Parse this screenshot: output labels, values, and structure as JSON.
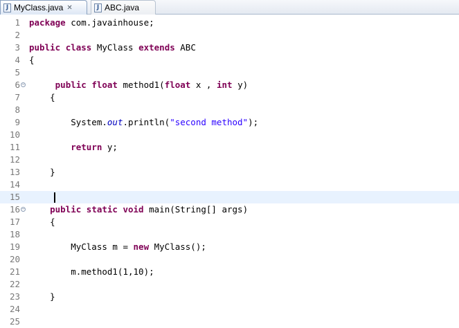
{
  "tabs": [
    {
      "label": "MyClass.java",
      "active": true,
      "icon": "java-file-icon",
      "close_glyph": "✕"
    },
    {
      "label": "ABC.java",
      "active": false,
      "icon": "java-file-icon"
    }
  ],
  "icon_glyph": "J",
  "fold_glyph": "−",
  "colors": {
    "keyword": "#7f0055",
    "string": "#2a00ff",
    "static_field": "#0000c0",
    "line_number": "#787878",
    "current_line": "#e8f2fe"
  },
  "editor": {
    "current_line": 15,
    "lines": [
      {
        "n": "1",
        "t": [
          {
            "k": "kw",
            "s": "package"
          },
          {
            "s": " com.javainhouse;"
          }
        ]
      },
      {
        "n": "2",
        "t": []
      },
      {
        "n": "3",
        "t": [
          {
            "k": "kw",
            "s": "public"
          },
          {
            "s": " "
          },
          {
            "k": "kw",
            "s": "class"
          },
          {
            "s": " MyClass "
          },
          {
            "k": "kw",
            "s": "extends"
          },
          {
            "s": " ABC"
          }
        ]
      },
      {
        "n": "4",
        "t": [
          {
            "s": "{"
          }
        ]
      },
      {
        "n": "5",
        "t": []
      },
      {
        "n": "6",
        "fold": true,
        "t": [
          {
            "s": "     "
          },
          {
            "k": "kw",
            "s": "public"
          },
          {
            "s": " "
          },
          {
            "k": "kw",
            "s": "float"
          },
          {
            "s": " method1("
          },
          {
            "k": "kw",
            "s": "float"
          },
          {
            "s": " x , "
          },
          {
            "k": "kw",
            "s": "int"
          },
          {
            "s": " y)"
          }
        ]
      },
      {
        "n": "7",
        "t": [
          {
            "s": "    {"
          }
        ]
      },
      {
        "n": "8",
        "t": []
      },
      {
        "n": "9",
        "t": [
          {
            "s": "        System."
          },
          {
            "k": "field",
            "s": "out"
          },
          {
            "s": ".println("
          },
          {
            "k": "str",
            "s": "\"second method\""
          },
          {
            "s": ");"
          }
        ]
      },
      {
        "n": "10",
        "t": []
      },
      {
        "n": "11",
        "t": [
          {
            "s": "        "
          },
          {
            "k": "kw",
            "s": "return"
          },
          {
            "s": " y;"
          }
        ]
      },
      {
        "n": "12",
        "t": []
      },
      {
        "n": "13",
        "t": [
          {
            "s": "    }"
          }
        ]
      },
      {
        "n": "14",
        "t": []
      },
      {
        "n": "15",
        "t": []
      },
      {
        "n": "16",
        "fold": true,
        "t": [
          {
            "s": "    "
          },
          {
            "k": "kw",
            "s": "public"
          },
          {
            "s": " "
          },
          {
            "k": "kw",
            "s": "static"
          },
          {
            "s": " "
          },
          {
            "k": "kw",
            "s": "void"
          },
          {
            "s": " main(String[] args)"
          }
        ]
      },
      {
        "n": "17",
        "t": [
          {
            "s": "    {"
          }
        ]
      },
      {
        "n": "18",
        "t": []
      },
      {
        "n": "19",
        "t": [
          {
            "s": "        MyClass m = "
          },
          {
            "k": "kw",
            "s": "new"
          },
          {
            "s": " MyClass();"
          }
        ]
      },
      {
        "n": "20",
        "t": []
      },
      {
        "n": "21",
        "t": [
          {
            "s": "        m.method1(1,10);"
          }
        ]
      },
      {
        "n": "22",
        "t": []
      },
      {
        "n": "23",
        "t": [
          {
            "s": "    }"
          }
        ]
      },
      {
        "n": "24",
        "t": []
      },
      {
        "n": "25",
        "t": []
      }
    ]
  }
}
